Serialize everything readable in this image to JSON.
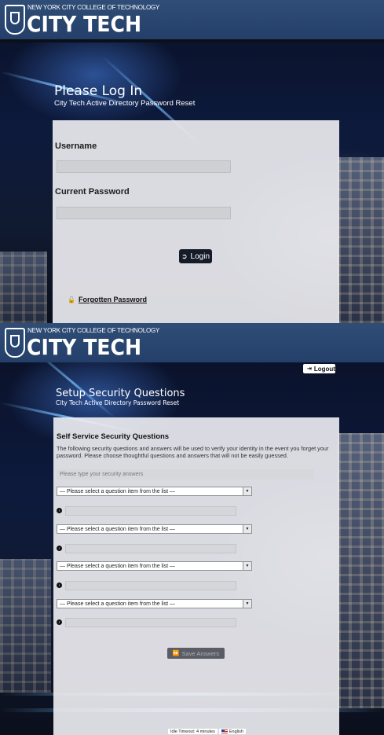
{
  "brand": {
    "college": "NEW YORK CITY COLLEGE OF TECHNOLOGY",
    "name": "CITY TECH"
  },
  "login": {
    "title": "Please Log In",
    "subtitle": "City Tech Active Directory Password Reset",
    "username_label": "Username",
    "username_value": "",
    "password_label": "Current Password",
    "password_value": "",
    "login_button": "Login",
    "login_icon": "sign-in-icon",
    "forgot_link": "Forgotten Password",
    "forgot_icon": "unlock-icon"
  },
  "setup": {
    "logout_button": "Logout",
    "logout_icon": "sign-out-icon",
    "title": "Setup Security Questions",
    "subtitle": "City Tech Active Directory Password Reset",
    "section_title": "Self Service Security Questions",
    "description": "The following security questions and answers will be used to verify your identity in the event you forget your password. Please choose thoughtful questions and answers that will not be easily guessed.",
    "hint": "Please type your security answers",
    "questions": [
      {
        "selected": "— Please select a question item from the list —",
        "answer": ""
      },
      {
        "selected": "— Please select a question item from the list —",
        "answer": ""
      },
      {
        "selected": "— Please select a question item from the list —",
        "answer": ""
      },
      {
        "selected": "— Please select a question item from the list —",
        "answer": ""
      }
    ],
    "save_button": "Save Answers",
    "save_icon": "fast-forward-icon"
  },
  "footer": {
    "idle_timeout": "Idle Timeout: 4 minutes",
    "language": "English"
  },
  "colors": {
    "header": "#24406a",
    "panel": "#ebecf0",
    "button_dark": "#151b28"
  }
}
